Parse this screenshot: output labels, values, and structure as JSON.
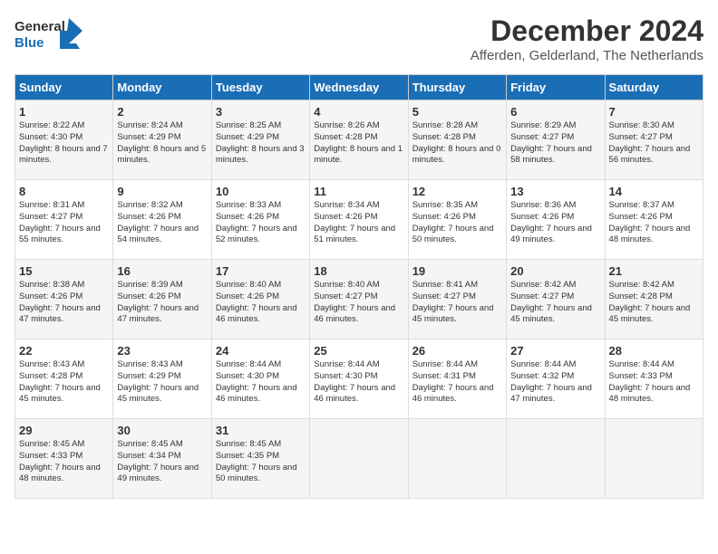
{
  "header": {
    "logo_line1": "General",
    "logo_line2": "Blue",
    "month": "December 2024",
    "location": "Afferden, Gelderland, The Netherlands"
  },
  "days_of_week": [
    "Sunday",
    "Monday",
    "Tuesday",
    "Wednesday",
    "Thursday",
    "Friday",
    "Saturday"
  ],
  "weeks": [
    [
      {
        "num": "1",
        "sunrise": "8:22 AM",
        "sunset": "4:30 PM",
        "daylight": "8 hours and 7 minutes."
      },
      {
        "num": "2",
        "sunrise": "8:24 AM",
        "sunset": "4:29 PM",
        "daylight": "8 hours and 5 minutes."
      },
      {
        "num": "3",
        "sunrise": "8:25 AM",
        "sunset": "4:29 PM",
        "daylight": "8 hours and 3 minutes."
      },
      {
        "num": "4",
        "sunrise": "8:26 AM",
        "sunset": "4:28 PM",
        "daylight": "8 hours and 1 minute."
      },
      {
        "num": "5",
        "sunrise": "8:28 AM",
        "sunset": "4:28 PM",
        "daylight": "8 hours and 0 minutes."
      },
      {
        "num": "6",
        "sunrise": "8:29 AM",
        "sunset": "4:27 PM",
        "daylight": "7 hours and 58 minutes."
      },
      {
        "num": "7",
        "sunrise": "8:30 AM",
        "sunset": "4:27 PM",
        "daylight": "7 hours and 56 minutes."
      }
    ],
    [
      {
        "num": "8",
        "sunrise": "8:31 AM",
        "sunset": "4:27 PM",
        "daylight": "7 hours and 55 minutes."
      },
      {
        "num": "9",
        "sunrise": "8:32 AM",
        "sunset": "4:26 PM",
        "daylight": "7 hours and 54 minutes."
      },
      {
        "num": "10",
        "sunrise": "8:33 AM",
        "sunset": "4:26 PM",
        "daylight": "7 hours and 52 minutes."
      },
      {
        "num": "11",
        "sunrise": "8:34 AM",
        "sunset": "4:26 PM",
        "daylight": "7 hours and 51 minutes."
      },
      {
        "num": "12",
        "sunrise": "8:35 AM",
        "sunset": "4:26 PM",
        "daylight": "7 hours and 50 minutes."
      },
      {
        "num": "13",
        "sunrise": "8:36 AM",
        "sunset": "4:26 PM",
        "daylight": "7 hours and 49 minutes."
      },
      {
        "num": "14",
        "sunrise": "8:37 AM",
        "sunset": "4:26 PM",
        "daylight": "7 hours and 48 minutes."
      }
    ],
    [
      {
        "num": "15",
        "sunrise": "8:38 AM",
        "sunset": "4:26 PM",
        "daylight": "7 hours and 47 minutes."
      },
      {
        "num": "16",
        "sunrise": "8:39 AM",
        "sunset": "4:26 PM",
        "daylight": "7 hours and 47 minutes."
      },
      {
        "num": "17",
        "sunrise": "8:40 AM",
        "sunset": "4:26 PM",
        "daylight": "7 hours and 46 minutes."
      },
      {
        "num": "18",
        "sunrise": "8:40 AM",
        "sunset": "4:27 PM",
        "daylight": "7 hours and 46 minutes."
      },
      {
        "num": "19",
        "sunrise": "8:41 AM",
        "sunset": "4:27 PM",
        "daylight": "7 hours and 45 minutes."
      },
      {
        "num": "20",
        "sunrise": "8:42 AM",
        "sunset": "4:27 PM",
        "daylight": "7 hours and 45 minutes."
      },
      {
        "num": "21",
        "sunrise": "8:42 AM",
        "sunset": "4:28 PM",
        "daylight": "7 hours and 45 minutes."
      }
    ],
    [
      {
        "num": "22",
        "sunrise": "8:43 AM",
        "sunset": "4:28 PM",
        "daylight": "7 hours and 45 minutes."
      },
      {
        "num": "23",
        "sunrise": "8:43 AM",
        "sunset": "4:29 PM",
        "daylight": "7 hours and 45 minutes."
      },
      {
        "num": "24",
        "sunrise": "8:44 AM",
        "sunset": "4:30 PM",
        "daylight": "7 hours and 46 minutes."
      },
      {
        "num": "25",
        "sunrise": "8:44 AM",
        "sunset": "4:30 PM",
        "daylight": "7 hours and 46 minutes."
      },
      {
        "num": "26",
        "sunrise": "8:44 AM",
        "sunset": "4:31 PM",
        "daylight": "7 hours and 46 minutes."
      },
      {
        "num": "27",
        "sunrise": "8:44 AM",
        "sunset": "4:32 PM",
        "daylight": "7 hours and 47 minutes."
      },
      {
        "num": "28",
        "sunrise": "8:44 AM",
        "sunset": "4:33 PM",
        "daylight": "7 hours and 48 minutes."
      }
    ],
    [
      {
        "num": "29",
        "sunrise": "8:45 AM",
        "sunset": "4:33 PM",
        "daylight": "7 hours and 48 minutes."
      },
      {
        "num": "30",
        "sunrise": "8:45 AM",
        "sunset": "4:34 PM",
        "daylight": "7 hours and 49 minutes."
      },
      {
        "num": "31",
        "sunrise": "8:45 AM",
        "sunset": "4:35 PM",
        "daylight": "7 hours and 50 minutes."
      },
      null,
      null,
      null,
      null
    ]
  ],
  "labels": {
    "sunrise": "Sunrise:",
    "sunset": "Sunset:",
    "daylight": "Daylight:"
  }
}
